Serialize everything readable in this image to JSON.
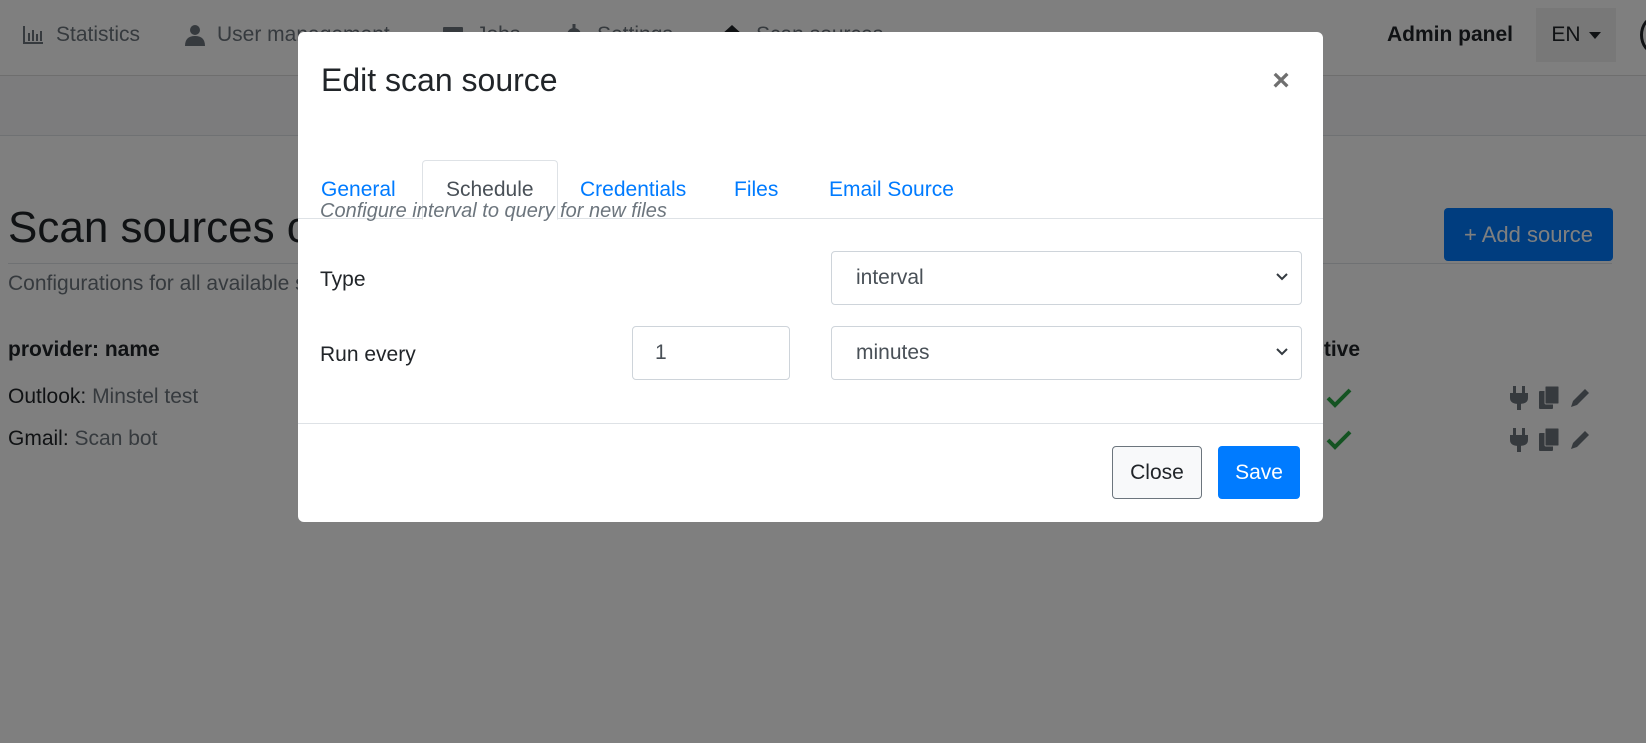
{
  "nav": {
    "items": [
      {
        "label": "Statistics",
        "icon": "bar-chart-icon"
      },
      {
        "label": "User management",
        "icon": "user-icon"
      },
      {
        "label": "Jobs",
        "icon": "server-icon"
      },
      {
        "label": "Settings",
        "icon": "gear-icon"
      },
      {
        "label": "Scan sources",
        "icon": "home-icon"
      }
    ],
    "title": "Admin panel",
    "language": "EN"
  },
  "page": {
    "title": "Scan sources configuration",
    "subtitle": "Configurations for all available scan sources",
    "add_button": "+ Add source",
    "columns": {
      "name": "provider: name",
      "active": "Active"
    },
    "rows": [
      {
        "provider": "Outlook:",
        "name": "Minstel test",
        "active": true
      },
      {
        "provider": "Gmail:",
        "name": "Scan bot",
        "active": true
      }
    ]
  },
  "modal": {
    "title": "Edit scan source",
    "close_symbol": "×",
    "tabs": [
      {
        "label": "General",
        "active": false
      },
      {
        "label": "Schedule",
        "active": true
      },
      {
        "label": "Credentials",
        "active": false
      },
      {
        "label": "Files",
        "active": false
      },
      {
        "label": "Email Source",
        "active": false
      }
    ],
    "hint": "Configure interval to query for new files",
    "type_label": "Type",
    "type_value": "interval",
    "run_every_label": "Run every",
    "run_every_value": "1",
    "unit_value": "minutes",
    "close_button": "Close",
    "save_button": "Save"
  },
  "colors": {
    "primary": "#007bff",
    "success": "#28a745",
    "backdrop": "rgba(0,0,0,0.5)"
  }
}
